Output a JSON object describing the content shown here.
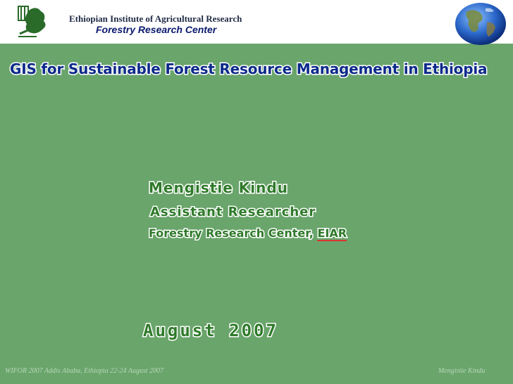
{
  "header": {
    "organization": "Ethiopian Institute of Agricultural Research",
    "center": "Forestry Research Center",
    "logo_icon": "eiar-logo-icon",
    "globe_icon": "globe-icon"
  },
  "slide": {
    "title": "GIS for Sustainable Forest Resource Management in Ethiopia",
    "author": "Mengistie Kindu",
    "role": "Assistant Researcher",
    "affiliation_prefix": "Forestry Research Center, ",
    "affiliation_org": "EIAR",
    "date": "August  2007"
  },
  "footer": {
    "left": "WIFOR 2007  Addis Ababa, Ethiopia 22-24 August 2007",
    "right": "Mengistie Kindu"
  },
  "colors": {
    "background": "#6aa56c",
    "title": "#0c2a8a",
    "text_green": "#2f7a2a",
    "header_navy": "#0b1a6e"
  }
}
